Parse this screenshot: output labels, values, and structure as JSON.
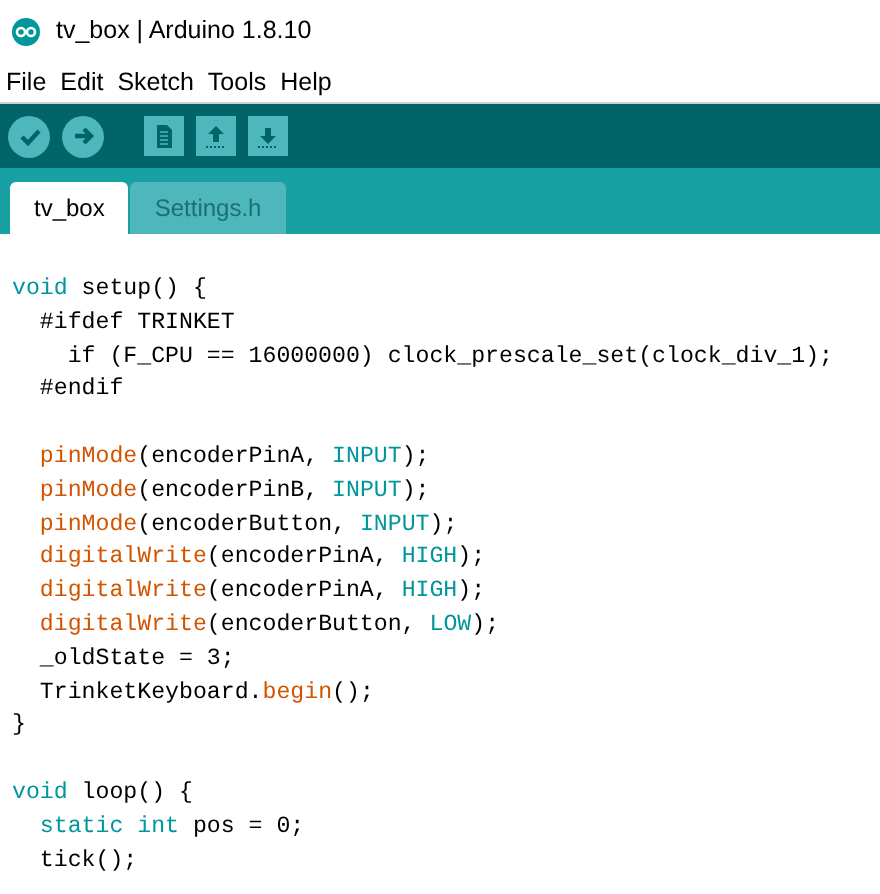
{
  "window": {
    "title": "tv_box | Arduino 1.8.10"
  },
  "menu": [
    "File",
    "Edit",
    "Sketch",
    "Tools",
    "Help"
  ],
  "toolbar": [
    {
      "kind": "verify"
    },
    {
      "kind": "upload"
    },
    {
      "kind": "new"
    },
    {
      "kind": "open"
    },
    {
      "kind": "save"
    }
  ],
  "tabs": [
    {
      "label": "tv_box",
      "selected": true
    },
    {
      "label": "Settings.h",
      "selected": false
    }
  ],
  "code": [
    {
      "kind": "code",
      "tokens": [
        {
          "kind": "type",
          "s": "void"
        },
        {
          "kind": "plain",
          "s": " setup() {"
        }
      ]
    },
    {
      "kind": "code",
      "tokens": [
        {
          "kind": "plain",
          "s": "  #ifdef TRINKET"
        }
      ]
    },
    {
      "kind": "code",
      "tokens": [
        {
          "kind": "plain",
          "s": "    if (F_CPU == 16000000) clock_prescale_set(clock_div_1);"
        }
      ]
    },
    {
      "kind": "code",
      "tokens": [
        {
          "kind": "plain",
          "s": "  #endif"
        }
      ]
    },
    {
      "kind": "blank"
    },
    {
      "kind": "code",
      "tokens": [
        {
          "kind": "func",
          "s": "  pinMode"
        },
        {
          "kind": "plain",
          "s": "(encoderPinA, "
        },
        {
          "kind": "const",
          "s": "INPUT"
        },
        {
          "kind": "plain",
          "s": ");"
        }
      ]
    },
    {
      "kind": "code",
      "tokens": [
        {
          "kind": "func",
          "s": "  pinMode"
        },
        {
          "kind": "plain",
          "s": "(encoderPinB, "
        },
        {
          "kind": "const",
          "s": "INPUT"
        },
        {
          "kind": "plain",
          "s": ");"
        }
      ]
    },
    {
      "kind": "code",
      "tokens": [
        {
          "kind": "func",
          "s": "  pinMode"
        },
        {
          "kind": "plain",
          "s": "(encoderButton, "
        },
        {
          "kind": "const",
          "s": "INPUT"
        },
        {
          "kind": "plain",
          "s": ");"
        }
      ]
    },
    {
      "kind": "code",
      "tokens": [
        {
          "kind": "func",
          "s": "  digitalWrite"
        },
        {
          "kind": "plain",
          "s": "(encoderPinA, "
        },
        {
          "kind": "const",
          "s": "HIGH"
        },
        {
          "kind": "plain",
          "s": ");"
        }
      ]
    },
    {
      "kind": "code",
      "tokens": [
        {
          "kind": "func",
          "s": "  digitalWrite"
        },
        {
          "kind": "plain",
          "s": "(encoderPinA, "
        },
        {
          "kind": "const",
          "s": "HIGH"
        },
        {
          "kind": "plain",
          "s": ");"
        }
      ]
    },
    {
      "kind": "code",
      "tokens": [
        {
          "kind": "func",
          "s": "  digitalWrite"
        },
        {
          "kind": "plain",
          "s": "(encoderButton, "
        },
        {
          "kind": "const",
          "s": "LOW"
        },
        {
          "kind": "plain",
          "s": ");"
        }
      ]
    },
    {
      "kind": "code",
      "tokens": [
        {
          "kind": "plain",
          "s": "  _oldState = 3;"
        }
      ]
    },
    {
      "kind": "code",
      "tokens": [
        {
          "kind": "plain",
          "s": "  TrinketKeyboard."
        },
        {
          "kind": "func",
          "s": "begin"
        },
        {
          "kind": "plain",
          "s": "();"
        }
      ]
    },
    {
      "kind": "code",
      "tokens": [
        {
          "kind": "plain",
          "s": "}"
        }
      ]
    },
    {
      "kind": "blank"
    },
    {
      "kind": "code",
      "tokens": [
        {
          "kind": "type",
          "s": "void"
        },
        {
          "kind": "plain",
          "s": " loop() {"
        }
      ]
    },
    {
      "kind": "code",
      "tokens": [
        {
          "kind": "type",
          "s": "  static int"
        },
        {
          "kind": "plain",
          "s": " pos = 0;"
        }
      ]
    },
    {
      "kind": "code",
      "tokens": [
        {
          "kind": "plain",
          "s": "  tick();"
        }
      ]
    }
  ]
}
